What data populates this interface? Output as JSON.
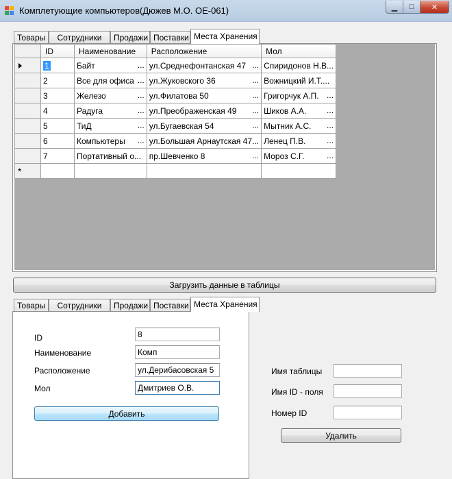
{
  "window": {
    "title": "Комплетующие компьютеров(Дюжев М.О. ОЕ-061)",
    "min_glyph": "▁",
    "max_glyph": "□",
    "close_glyph": "✕",
    "icon": "app-window-icon",
    "icon_colors": [
      "#e8453c",
      "#f4b400",
      "#34a853",
      "#4285f4"
    ]
  },
  "top_tabs": {
    "items": [
      "Товары",
      "Сотрудники",
      "Продажи",
      "Поставки",
      "Места Хранения"
    ],
    "active": "Места Хранения"
  },
  "grid": {
    "columns": [
      "ID",
      "Наименование",
      "Расположение",
      "Мол"
    ],
    "rows": [
      [
        "1",
        "Байт",
        "ул.Среднефонтанская 47",
        "Спиридонов Н.В..."
      ],
      [
        "2",
        "Все для офиса",
        "ул.Жуковского 36",
        "Вожницкий И.Т...."
      ],
      [
        "3",
        "Железо",
        "ул.Филатова 50",
        "Григорчук А.П."
      ],
      [
        "4",
        "Радуга",
        "ул.Преображенская 49",
        "Шиков А.А."
      ],
      [
        "5",
        "ТиД",
        "ул.Бугаевская 54",
        "Мытник А.С."
      ],
      [
        "6",
        "Компьютеры",
        "ул.Большая Арнаутская 47...",
        "Ленец П.В."
      ],
      [
        "7",
        "Портативный о...",
        "пр.Шевченко 8",
        "Мороз С.Г."
      ]
    ],
    "current_row_marker": "▶",
    "new_row_marker": "*",
    "colors": {
      "background": "#ababab",
      "selection": "#3399ff"
    }
  },
  "load_button": {
    "label": "Загрузить данные в таблицы"
  },
  "bottom_tabs": {
    "items": [
      "Товары",
      "Сотрудники",
      "Продажи",
      "Поставки",
      "Места Хранения"
    ],
    "active": "Места Хранения"
  },
  "form": {
    "fields": [
      {
        "label": "ID",
        "value": "8"
      },
      {
        "label": "Наименование",
        "value": "Комп"
      },
      {
        "label": "Расположение",
        "value": "ул.Дерибасовская 5"
      },
      {
        "label": "Мол",
        "value": "Дмитриев О.В."
      }
    ],
    "add_button": "Добавить"
  },
  "delete_form": {
    "fields": [
      {
        "label": "Имя таблицы",
        "value": ""
      },
      {
        "label": "Имя ID - поля",
        "value": ""
      },
      {
        "label": "Номер ID",
        "value": ""
      }
    ],
    "delete_button": "Удалить"
  }
}
